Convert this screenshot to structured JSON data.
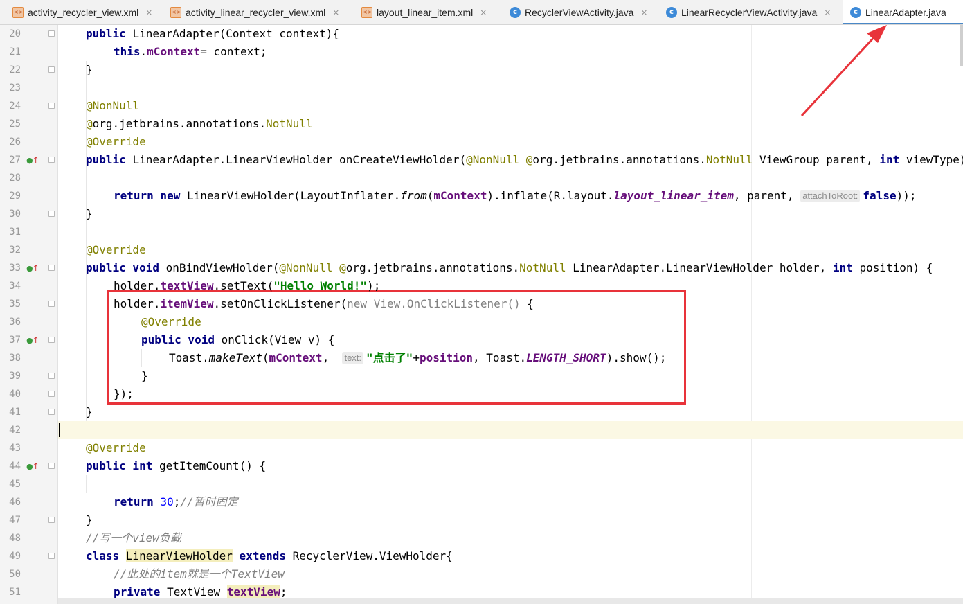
{
  "tabs": [
    {
      "label": "activity_recycler_view.xml",
      "type": "xml",
      "active": false
    },
    {
      "label": "activity_linear_recycler_view.xml",
      "type": "xml",
      "active": false
    },
    {
      "label": "layout_linear_item.xml",
      "type": "xml",
      "active": false
    },
    {
      "label": "RecyclerViewActivity.java",
      "type": "java",
      "active": false
    },
    {
      "label": "LinearRecyclerViewActivity.java",
      "type": "java",
      "active": false
    },
    {
      "label": "LinearAdapter.java",
      "type": "java",
      "active": true
    }
  ],
  "tab_close_glyph": "×",
  "java_icon_letter": "c",
  "current_line": 42,
  "lines": [
    {
      "n": "20",
      "indent": 1,
      "fold": true,
      "segs": [
        [
          "kw",
          "public "
        ],
        [
          "",
          "LinearAdapter(Context context){"
        ]
      ]
    },
    {
      "n": "21",
      "indent": 2,
      "segs": [
        [
          "kw",
          "this"
        ],
        [
          "",
          "."
        ],
        [
          "fld",
          "mContext"
        ],
        [
          "",
          "= context;"
        ]
      ]
    },
    {
      "n": "22",
      "indent": 1,
      "fold": true,
      "segs": [
        [
          "",
          "}"
        ]
      ]
    },
    {
      "n": "23",
      "indent": 0,
      "segs": []
    },
    {
      "n": "24",
      "indent": 1,
      "fold": true,
      "segs": [
        [
          "ann",
          "@NonNull"
        ]
      ]
    },
    {
      "n": "25",
      "indent": 1,
      "segs": [
        [
          "ann",
          "@"
        ],
        [
          "",
          "org.jetbrains.annotations."
        ],
        [
          "ann",
          "NotNull"
        ]
      ]
    },
    {
      "n": "26",
      "indent": 1,
      "segs": [
        [
          "ann",
          "@Override"
        ]
      ]
    },
    {
      "n": "27",
      "indent": 1,
      "fold": true,
      "mark": true,
      "segs": [
        [
          "kw",
          "public "
        ],
        [
          "",
          "LinearAdapter.LinearViewHolder onCreateViewHolder("
        ],
        [
          "ann",
          "@NonNull "
        ],
        [
          "ann",
          "@"
        ],
        [
          "",
          "org.jetbrains.annotations."
        ],
        [
          "ann",
          "NotNull "
        ],
        [
          "",
          "ViewGroup parent, "
        ],
        [
          "kw",
          "int "
        ],
        [
          "",
          "viewType) {"
        ]
      ]
    },
    {
      "n": "28",
      "indent": 0,
      "segs": []
    },
    {
      "n": "29",
      "indent": 2,
      "segs": [
        [
          "kw",
          "return new "
        ],
        [
          "",
          "LinearViewHolder(LayoutInflater."
        ],
        [
          "ital",
          "from"
        ],
        [
          "",
          "("
        ],
        [
          "fld",
          "mContext"
        ],
        [
          "",
          ").inflate(R.layout."
        ],
        [
          "static",
          "layout_linear_item"
        ],
        [
          "",
          ", parent, "
        ],
        [
          "hint",
          "attachToRoot:"
        ],
        [
          "kw",
          "false"
        ],
        [
          "",
          "));"
        ]
      ]
    },
    {
      "n": "30",
      "indent": 1,
      "fold": true,
      "segs": [
        [
          "",
          "}"
        ]
      ]
    },
    {
      "n": "31",
      "indent": 0,
      "segs": []
    },
    {
      "n": "32",
      "indent": 1,
      "segs": [
        [
          "ann",
          "@Override"
        ]
      ]
    },
    {
      "n": "33",
      "indent": 1,
      "fold": true,
      "mark": true,
      "segs": [
        [
          "kw",
          "public void "
        ],
        [
          "",
          "onBindViewHolder("
        ],
        [
          "ann",
          "@NonNull "
        ],
        [
          "ann",
          "@"
        ],
        [
          "",
          "org.jetbrains.annotations."
        ],
        [
          "ann",
          "NotNull "
        ],
        [
          "",
          "LinearAdapter.LinearViewHolder holder, "
        ],
        [
          "kw",
          "int "
        ],
        [
          "",
          "position) {"
        ]
      ]
    },
    {
      "n": "34",
      "indent": 2,
      "segs": [
        [
          "",
          "holder."
        ],
        [
          "fld",
          "textView"
        ],
        [
          "",
          ".setText("
        ],
        [
          "str",
          "\"Hello World!\""
        ],
        [
          "",
          ");"
        ]
      ]
    },
    {
      "n": "35",
      "indent": 2,
      "fold": true,
      "segs": [
        [
          "",
          "holder."
        ],
        [
          "fld",
          "itemView"
        ],
        [
          "",
          ".setOnClickListener("
        ],
        [
          "gray",
          "new View.OnClickListener() "
        ],
        [
          "",
          "{"
        ]
      ]
    },
    {
      "n": "36",
      "indent": 3,
      "segs": [
        [
          "ann",
          "@Override"
        ]
      ]
    },
    {
      "n": "37",
      "indent": 3,
      "fold": true,
      "mark": true,
      "segs": [
        [
          "kw",
          "public void "
        ],
        [
          "",
          "onClick(View v) {"
        ]
      ]
    },
    {
      "n": "38",
      "indent": 4,
      "segs": [
        [
          "",
          "Toast."
        ],
        [
          "ital",
          "makeText"
        ],
        [
          "",
          "("
        ],
        [
          "fld",
          "mContext"
        ],
        [
          "",
          ",  "
        ],
        [
          "hint",
          "text:"
        ],
        [
          "str",
          "\"点击了\""
        ],
        [
          "",
          "+"
        ],
        [
          "fld",
          "position"
        ],
        [
          "",
          ", Toast."
        ],
        [
          "static",
          "LENGTH_SHORT"
        ],
        [
          "",
          ").show();"
        ]
      ]
    },
    {
      "n": "39",
      "indent": 3,
      "fold": true,
      "segs": [
        [
          "",
          "}"
        ]
      ]
    },
    {
      "n": "40",
      "indent": 2,
      "fold": true,
      "segs": [
        [
          "",
          "});"
        ]
      ]
    },
    {
      "n": "41",
      "indent": 1,
      "fold": true,
      "segs": [
        [
          "",
          "}"
        ]
      ]
    },
    {
      "n": "42",
      "indent": 0,
      "segs": []
    },
    {
      "n": "43",
      "indent": 1,
      "segs": [
        [
          "ann",
          "@Override"
        ]
      ]
    },
    {
      "n": "44",
      "indent": 1,
      "fold": true,
      "mark": true,
      "segs": [
        [
          "kw",
          "public int "
        ],
        [
          "",
          "getItemCount() {"
        ]
      ]
    },
    {
      "n": "45",
      "indent": 0,
      "segs": []
    },
    {
      "n": "46",
      "indent": 2,
      "segs": [
        [
          "kw",
          "return "
        ],
        [
          "num",
          "30"
        ],
        [
          "",
          ";"
        ],
        [
          "cmt",
          "//暂时固定"
        ]
      ]
    },
    {
      "n": "47",
      "indent": 1,
      "fold": true,
      "segs": [
        [
          "",
          "}"
        ]
      ]
    },
    {
      "n": "48",
      "indent": 1,
      "segs": [
        [
          "cmt",
          "//写一个view负载"
        ]
      ]
    },
    {
      "n": "49",
      "indent": 1,
      "fold": true,
      "segs": [
        [
          "kw",
          "class "
        ],
        [
          "hl",
          "LinearViewHolder"
        ],
        [
          "kw",
          " extends "
        ],
        [
          "",
          "RecyclerView.ViewHolder{"
        ]
      ]
    },
    {
      "n": "50",
      "indent": 2,
      "segs": [
        [
          "cmt",
          "//此处的item就是一个TextView"
        ]
      ]
    },
    {
      "n": "51",
      "indent": 2,
      "segs": [
        [
          "kw",
          "private "
        ],
        [
          "",
          "TextView "
        ],
        [
          "hlfld",
          "textView"
        ],
        [
          "",
          ";"
        ]
      ]
    }
  ],
  "colors": {
    "annotation_box": "#e8333a",
    "arrow": "#e8333a",
    "active_tab_underline": "#4a88c7"
  }
}
